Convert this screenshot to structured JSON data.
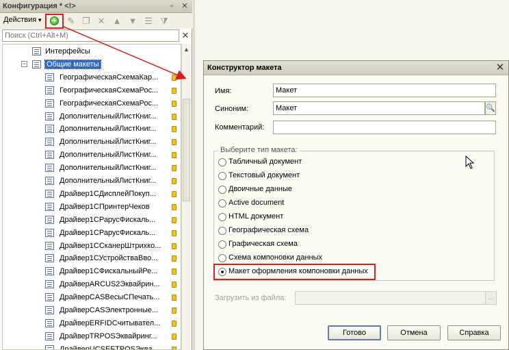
{
  "left_panel": {
    "title": "Конфигурация * <!>",
    "actions_label": "Действия",
    "search_placeholder": "Поиск (Ctrl+Alt+M)",
    "tree": [
      {
        "label": "Интерфейсы",
        "level": 1
      },
      {
        "label": "Общие макеты",
        "level": 1,
        "expanded": true,
        "selected": true
      },
      {
        "label": "ГеографическаяСхемаКар...",
        "level": 2
      },
      {
        "label": "ГеографическаяСхемаРос...",
        "level": 2
      },
      {
        "label": "ГеографическаяСхемаРос...",
        "level": 2
      },
      {
        "label": "ДополнительныйЛистКниг...",
        "level": 2
      },
      {
        "label": "ДополнительныйЛистКниг...",
        "level": 2
      },
      {
        "label": "ДополнительныйЛистКниг...",
        "level": 2
      },
      {
        "label": "ДополнительныйЛистКниг...",
        "level": 2
      },
      {
        "label": "ДополнительныйЛистКниг...",
        "level": 2
      },
      {
        "label": "ДополнительныйЛистКниг...",
        "level": 2
      },
      {
        "label": "Драйвер1СДисплейПокуп...",
        "level": 2
      },
      {
        "label": "Драйвер1СПринтерЧеков",
        "level": 2
      },
      {
        "label": "Драйвер1СРарусФискаль...",
        "level": 2
      },
      {
        "label": "Драйвер1СРарусФискаль...",
        "level": 2
      },
      {
        "label": "Драйвер1ССканерШтрихко...",
        "level": 2
      },
      {
        "label": "Драйвер1СУстройстваВво...",
        "level": 2
      },
      {
        "label": "Драйвер1СФискальныйРе...",
        "level": 2
      },
      {
        "label": "ДрайверARCUS2Эквайрин...",
        "level": 2
      },
      {
        "label": "ДрайверCASВесыСПечать...",
        "level": 2
      },
      {
        "label": "ДрайверCASЭлектронные...",
        "level": 2
      },
      {
        "label": "ДрайверERFIDСчитывател...",
        "level": 2
      },
      {
        "label": "ДрайверTRPOSЭквайринг...",
        "level": 2
      },
      {
        "label": "ДрайверUCSEFTPOSЭква...",
        "level": 2
      }
    ]
  },
  "dialog": {
    "title": "Конструктор макета",
    "name_label": "Имя:",
    "name_value": "Макет",
    "synonym_label": "Синоним:",
    "synonym_value": "Макет",
    "comment_label": "Комментарий:",
    "comment_value": "",
    "type_group_label": "Выберите тип макета:",
    "options": [
      {
        "label": "Табличный документ",
        "checked": false
      },
      {
        "label": "Текстовый документ",
        "checked": false
      },
      {
        "label": "Двоичные данные",
        "checked": false
      },
      {
        "label": "Active document",
        "checked": false
      },
      {
        "label": "HTML документ",
        "checked": false
      },
      {
        "label": "Географическая схема",
        "checked": false
      },
      {
        "label": "Графическая схема",
        "checked": false
      },
      {
        "label": "Схема компоновки данных",
        "checked": false
      },
      {
        "label": "Макет оформления компоновки данных",
        "checked": true
      }
    ],
    "load_label": "Загрузить из файла:",
    "load_button": "...",
    "ok_button": "Готово",
    "cancel_button": "Отмена",
    "help_button": "Справка"
  },
  "colors": {
    "highlight_red": "#d62020",
    "selection_blue": "#316ac5"
  }
}
